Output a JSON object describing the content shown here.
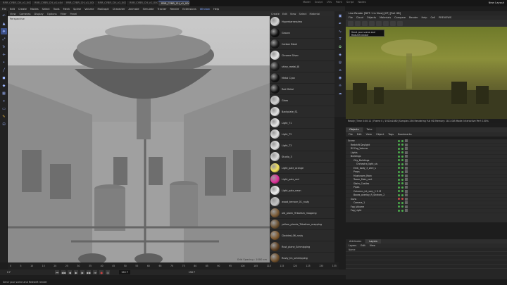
{
  "tabs": [
    {
      "label": "RRR_CYBR_CH_v1_0003.c4d*",
      "active": false
    },
    {
      "label": "RRR_CYBR_CH_v1.c4d*",
      "active": false
    },
    {
      "label": "RRR_CYBR_CH_v1_0004.c4d*",
      "active": false
    },
    {
      "label": "RRR_CYBR_CH_v1_0005.c4d*",
      "active": false
    },
    {
      "label": "RRR_CYBR_CH_v1_0006.c4d*",
      "active": false
    },
    {
      "label": "RRR_CYBR_CH_v1_0007.c4d*",
      "active": true
    }
  ],
  "workspaces": [
    "Model",
    "Sculpt",
    "UVs",
    "Paint",
    "Script",
    "Nodes"
  ],
  "new_layout": "New Layout",
  "menubar": [
    "File",
    "Edit",
    "Create",
    "Modes",
    "Select",
    "Tools",
    "Mesh",
    "Spline",
    "Volume",
    "MoGraph",
    "Character",
    "Animate",
    "Simulate",
    "Tracker",
    "Render",
    "Extensions",
    "Window",
    "Help"
  ],
  "viewport": {
    "menu": [
      "View",
      "Cameras",
      "Display",
      "Options",
      "Filter",
      "Panel"
    ],
    "label": "Perspective",
    "grid": "Grid Spacing : 1000 cm"
  },
  "materials_menu": [
    "Create",
    "Edit",
    "View",
    "Select",
    "Material"
  ],
  "materials": [
    {
      "name": "Hyperbarrassimo",
      "color": "#d8d8d8"
    },
    {
      "name": "Ground",
      "color": "#111111"
    },
    {
      "name": "Carbon Black",
      "color": "#1a1a1a"
    },
    {
      "name": "Chrome Silver",
      "color": "#e8e8e8"
    },
    {
      "name": "shiny_metal_Bl",
      "color": "#202020"
    },
    {
      "name": "Metal Cyan",
      "color": "#141414"
    },
    {
      "name": "Red Metal",
      "color": "#151515"
    },
    {
      "name": "Glass",
      "color": "#d5d5d5"
    },
    {
      "name": "Backplate_S1",
      "color": "#e6e6e6"
    },
    {
      "name": "Light_T1",
      "color": "#e9e9e9"
    },
    {
      "name": "Light_T2",
      "color": "#e2e2e2"
    },
    {
      "name": "Light_T3",
      "color": "#e4e4e4"
    },
    {
      "name": "Studio_3",
      "color": "#dcdcdc"
    },
    {
      "name": "Light_pale_orange",
      "color": "#f2e05a"
    },
    {
      "name": "Light_pale_red",
      "color": "#e0309a"
    },
    {
      "name": "Light_pale_neon",
      "color": "#f0f0f0"
    },
    {
      "name": "wood_terrace_01_rusty",
      "color": "#c4c4c4"
    },
    {
      "name": "old_plank_Tribalism_mapping",
      "color": "#7a5a35"
    },
    {
      "name": "yellow_planks_Tribalism_mapping",
      "color": "#6a5030"
    },
    {
      "name": "Cladded_06_rusty",
      "color": "#805a30"
    },
    {
      "name": "Rust_plane_Schmipping",
      "color": "#5e4022"
    },
    {
      "name": "Rusty_tin_schmipping",
      "color": "#70502c"
    }
  ],
  "picture_viewer": {
    "title": "Live Render [SDT: 1 in View] [07] [Full HD]",
    "menu": [
      "File",
      "Cloud",
      "Objects",
      "Materials",
      "Compare",
      "Render",
      "Help",
      "Cell",
      "PREVIEWS"
    ],
    "tooltip": "Send your scene and Redshift render",
    "status": "Ready [Time 0:00:11 / Frame 0 / 1920x1080] Samples 256 Rendering Full HD Memory: 18.1 GiB  Mode: Interactive  Perf: 100%"
  },
  "objects": {
    "tabs": [
      {
        "label": "Objects",
        "on": true
      },
      {
        "label": "Take",
        "on": false
      }
    ],
    "menu": [
      "File",
      "Edit",
      "View",
      "Object",
      "Tags",
      "Bookmarks"
    ],
    "rows": [
      {
        "name": "Scene",
        "indent": 0,
        "c": "g"
      },
      {
        "name": "Redshift Daylight",
        "indent": 1,
        "c": "g"
      },
      {
        "name": "RS Fog_Volume",
        "indent": 1,
        "c": "g"
      },
      {
        "name": "Lights",
        "indent": 1,
        "c": "g"
      },
      {
        "name": "Buildings",
        "indent": 1,
        "c": "g"
      },
      {
        "name": "City_Buildings",
        "indent": 2,
        "c": "g"
      },
      {
        "name": "Orchestra_light_sis",
        "indent": 3,
        "c": "g"
      },
      {
        "name": "Emb_body_3_wire_s",
        "indent": 2,
        "c": "g"
      },
      {
        "name": "Props",
        "indent": 2,
        "c": "g"
      },
      {
        "name": "Mushroom_Main",
        "indent": 2,
        "c": "g"
      },
      {
        "name": "Tower_Main_vert",
        "indent": 2,
        "c": "g"
      },
      {
        "name": "Stairs_Castles",
        "indent": 2,
        "c": "g"
      },
      {
        "name": "Pipes",
        "indent": 2,
        "c": "g"
      },
      {
        "name": "Columns_int_vary_1 G M",
        "indent": 2,
        "c": "g"
      },
      {
        "name": "Boxes_overlay_R_Shelves_2",
        "indent": 2,
        "c": "g"
      },
      {
        "name": "Guns",
        "indent": 1,
        "c": "r"
      },
      {
        "name": "Camera_1",
        "indent": 2,
        "c": "g"
      },
      {
        "name": "Fog_Volume",
        "indent": 1,
        "c": "g"
      },
      {
        "name": "Fog_Light",
        "indent": 1,
        "c": "g"
      }
    ]
  },
  "attributes": {
    "tabs": [
      {
        "label": "Attributes",
        "on": false
      },
      {
        "label": "Layers",
        "on": true
      }
    ],
    "menu": [
      "Layers",
      "Edit",
      "View"
    ],
    "rows": [
      "Name",
      "",
      "",
      "",
      ""
    ]
  },
  "timeline": {
    "ticks": [
      "0",
      "5",
      "10",
      "15",
      "20",
      "25",
      "30",
      "35",
      "40",
      "45",
      "50",
      "55",
      "60",
      "65",
      "70",
      "75",
      "80",
      "85",
      "90",
      "95",
      "100",
      "105",
      "110",
      "115",
      "120",
      "125",
      "130",
      "135"
    ],
    "current_frame": "150 F",
    "start": "0 F",
    "end": "150 F"
  },
  "status": "Send your scene and Redshift render",
  "colors": {
    "accent": "#5d7fd8",
    "viewport_bg": "#aeaeae",
    "render_tint": "#8b8f3a"
  }
}
